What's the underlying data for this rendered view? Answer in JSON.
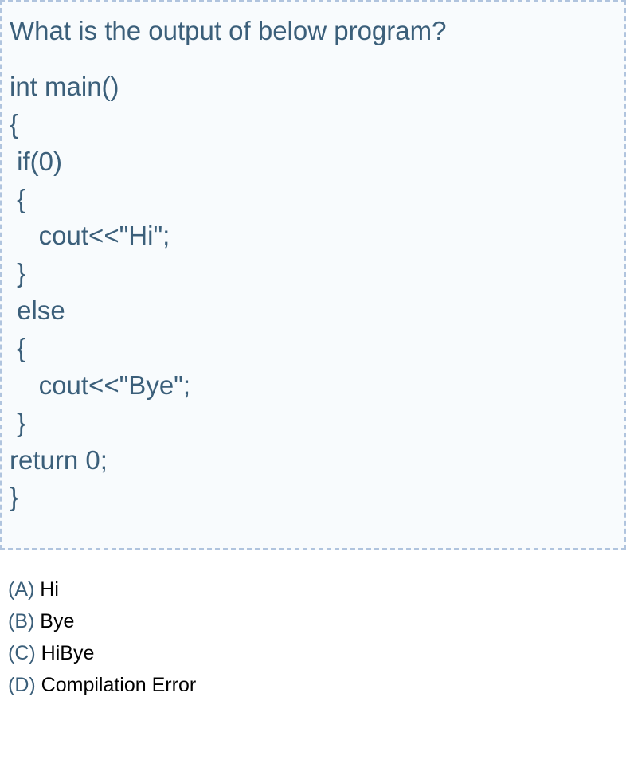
{
  "question": {
    "title": "What is the output of below program?",
    "code": "int main()\n{\n if(0)\n {\n    cout<<\"Hi\";\n }\n else\n {\n    cout<<\"Bye\";\n }\nreturn 0;\n}"
  },
  "answers": [
    {
      "label": "(A)",
      "text": " Hi"
    },
    {
      "label": "(B)",
      "text": " Bye"
    },
    {
      "label": "(C)",
      "text": " HiBye"
    },
    {
      "label": "(D)",
      "text": " Compilation Error"
    }
  ]
}
